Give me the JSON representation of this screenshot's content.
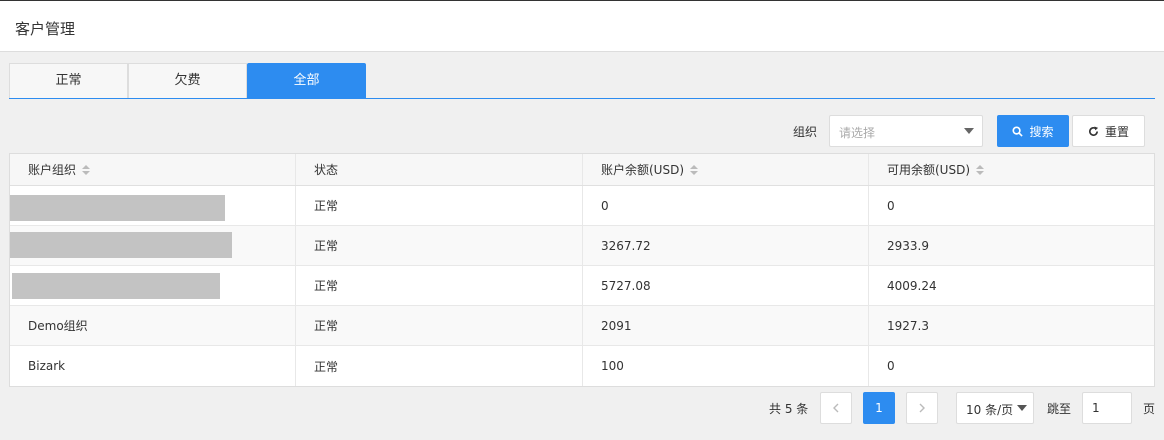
{
  "header": {
    "title": "客户管理"
  },
  "tabs": [
    {
      "label": "正常",
      "active": false
    },
    {
      "label": "欠费",
      "active": false
    },
    {
      "label": "全部",
      "active": true
    }
  ],
  "filter": {
    "org_label": "组织",
    "org_placeholder": "请选择",
    "search_label": "搜索",
    "reset_label": "重置"
  },
  "table": {
    "columns": [
      "账户组织",
      "状态",
      "账户余额(USD)",
      "可用余额(USD)"
    ],
    "rows": [
      {
        "org": "",
        "status": "正常",
        "balance": "0",
        "available": "0",
        "redacted": true
      },
      {
        "org": "",
        "status": "正常",
        "balance": "3267.72",
        "available": "2933.9",
        "redacted": true
      },
      {
        "org": "",
        "status": "正常",
        "balance": "5727.08",
        "available": "4009.24",
        "redacted": true
      },
      {
        "org": "Demo组织",
        "status": "正常",
        "balance": "2091",
        "available": "1927.3",
        "redacted": false
      },
      {
        "org": "Bizark",
        "status": "正常",
        "balance": "100",
        "available": "0",
        "redacted": false
      }
    ]
  },
  "pagination": {
    "total_text": "共 5 条",
    "current_page": "1",
    "page_size": "10 条/页",
    "jump_label": "跳至",
    "jump_value": "1",
    "jump_suffix": "页"
  },
  "colors": {
    "accent": "#2d8cf0",
    "redaction": "#c3c3c3"
  },
  "icons": {
    "search": "search-icon",
    "reset": "refresh-icon",
    "sort": "sort-icon",
    "prev": "chevron-left-icon",
    "next": "chevron-right-icon"
  }
}
